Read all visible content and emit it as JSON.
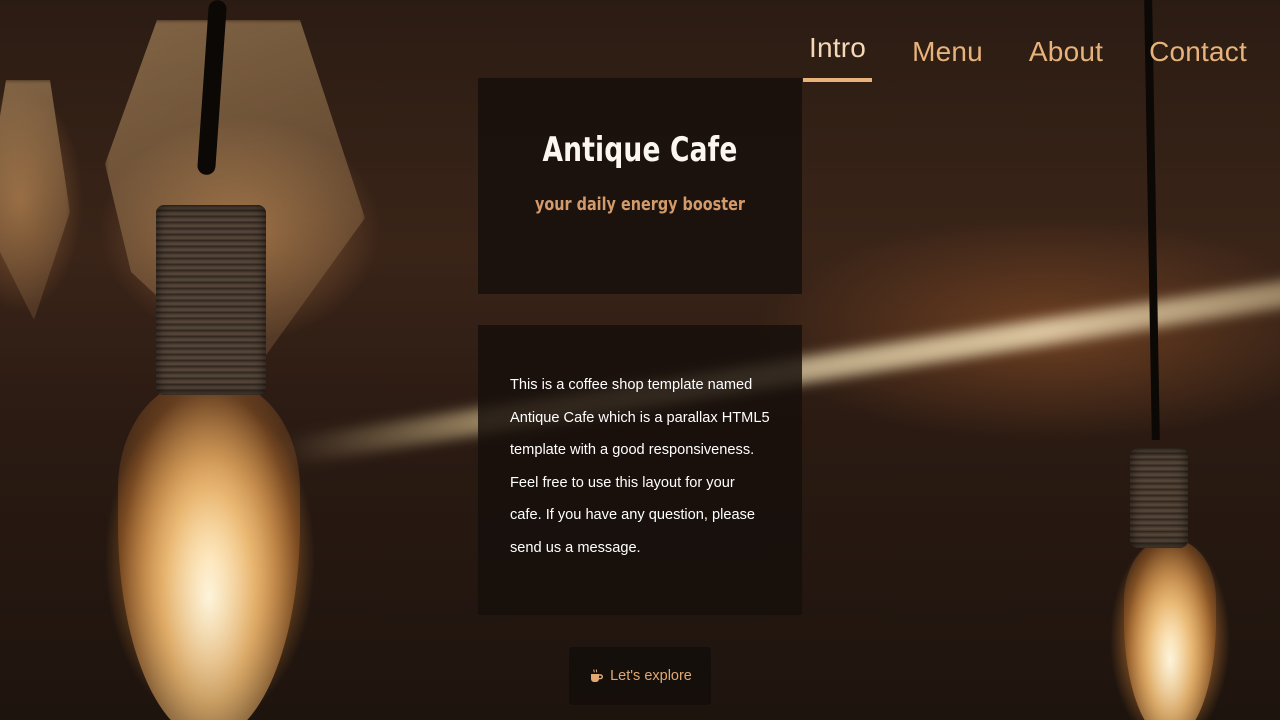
{
  "nav": {
    "items": [
      {
        "label": "Intro",
        "active": true
      },
      {
        "label": "Menu",
        "active": false
      },
      {
        "label": "About",
        "active": false
      },
      {
        "label": "Contact",
        "active": false
      }
    ]
  },
  "hero": {
    "title": "Antique Cafe",
    "tagline": "your daily energy booster"
  },
  "intro": {
    "description": "This is a coffee shop template named Antique Cafe which is a parallax HTML5 template with a good responsiveness. Feel free to use this layout for your cafe. If you have any question, please send us a message."
  },
  "cta": {
    "label": "Let's explore",
    "icon": "coffee-cup-icon"
  },
  "colors": {
    "accent": "#e8b27b",
    "panel_bg": "#160f0b",
    "tagline": "#d39a6a"
  }
}
